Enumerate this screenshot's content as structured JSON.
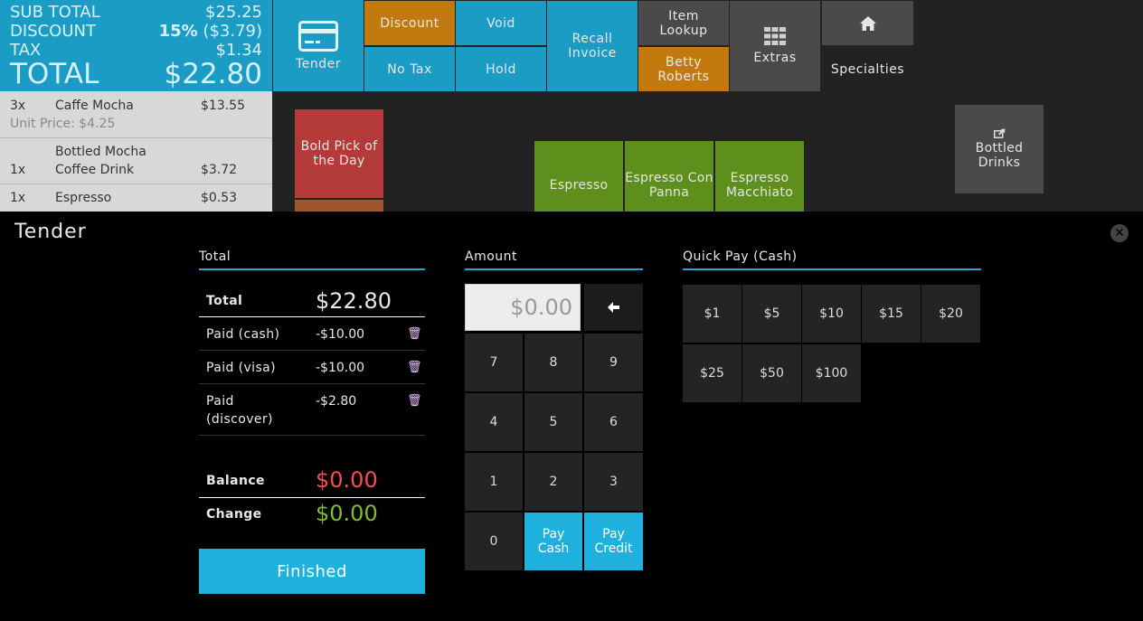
{
  "summary": {
    "subtotal_label": "SUB TOTAL",
    "subtotal_value": "$25.25",
    "discount_label": "DISCOUNT",
    "discount_percent": "15%",
    "discount_value": "($3.79)",
    "tax_label": "TAX",
    "tax_value": "$1.34",
    "total_label": "TOTAL",
    "total_value": "$22.80"
  },
  "order": [
    {
      "qty": "3x",
      "name": "Caffe Mocha",
      "price": "$13.55",
      "sub": "Unit Price: $4.25"
    },
    {
      "qty": "1x",
      "name_line1": "Bottled Mocha",
      "name_line2": "Coffee Drink",
      "price": "$3.72"
    },
    {
      "qty": "1x",
      "name": "Espresso",
      "price": "$0.53"
    }
  ],
  "toolbar": {
    "tender": "Tender",
    "discount": "Discount",
    "void": "Void",
    "no_tax": "No Tax",
    "hold": "Hold",
    "recall_line1": "Recall",
    "recall_line2": "Invoice",
    "item_lookup_line1": "Item",
    "item_lookup_line2": "Lookup",
    "betty_line1": "Betty",
    "betty_line2": "Roberts",
    "extras": "Extras",
    "specialties": "Specialties"
  },
  "tiles": {
    "bold_pick_line1": "Bold Pick of",
    "bold_pick_line2": "the Day",
    "espresso": "Espresso",
    "espresso_con_panna_line1": "Espresso Con",
    "espresso_con_panna_line2": "Panna",
    "espresso_macchiato_line1": "Espresso",
    "espresso_macchiato_line2": "Macchiato",
    "bottled_drinks": "Bottled Drinks"
  },
  "tender": {
    "title": "Tender",
    "total_header": "Total",
    "amount_header": "Amount",
    "quickpay_header": "Quick Pay (Cash)",
    "total_label": "Total",
    "total_value": "$22.80",
    "payments": [
      {
        "label": "Paid (cash)",
        "value": "-$10.00"
      },
      {
        "label": "Paid (visa)",
        "value": "-$10.00"
      },
      {
        "label_line1": "Paid",
        "label_line2": "(discover)",
        "value": "-$2.80"
      }
    ],
    "balance_label": "Balance",
    "balance_value": "$0.00",
    "change_label": "Change",
    "change_value": "$0.00",
    "finished": "Finished",
    "amount_value": "$0.00",
    "keys": [
      "7",
      "8",
      "9",
      "4",
      "5",
      "6",
      "1",
      "2",
      "3",
      "0"
    ],
    "pay_cash_line1": "Pay",
    "pay_cash_line2": "Cash",
    "pay_credit_line1": "Pay",
    "pay_credit_line2": "Credit",
    "quick_pay": [
      "$1",
      "$5",
      "$10",
      "$15",
      "$20",
      "$25",
      "$50",
      "$100"
    ]
  },
  "colors": {
    "accent_blue": "#1a9cc4",
    "orange": "#c27a0e",
    "green_tile": "#5e8e1c",
    "red_tile": "#b53a3a",
    "balance_red": "#ff4d4d",
    "change_green": "#7cbf2a"
  },
  "icons": {
    "tender": "credit-card-icon",
    "extras": "grid-icon",
    "specialties": "home-icon",
    "bottled_drinks": "share-icon",
    "close": "close-icon",
    "backspace": "arrow-left-icon",
    "remove_payment": "trash-icon"
  }
}
